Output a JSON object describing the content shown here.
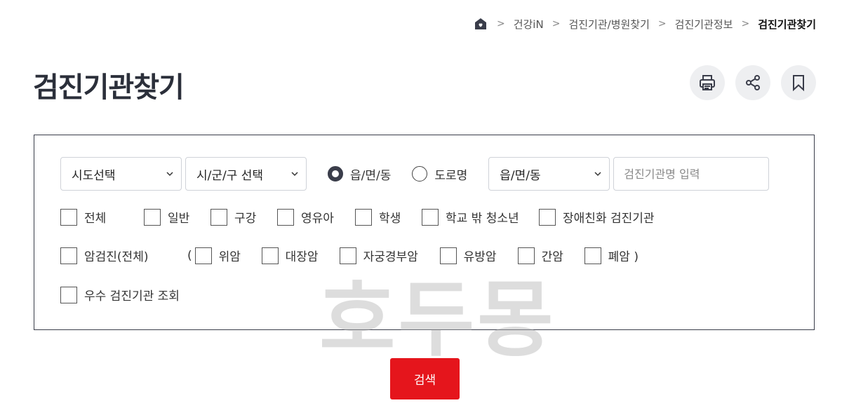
{
  "breadcrumb": {
    "items": [
      "건강iN",
      "검진기관/병원찾기",
      "검진기관정보"
    ],
    "current": "검진기관찾기"
  },
  "page_title": "검진기관찾기",
  "actions": {
    "icons": [
      "print-icon",
      "share-icon",
      "bookmark-icon"
    ]
  },
  "filters": {
    "sido_select": "시도선택",
    "sigungu_select": "시/군/구 선택",
    "radio_emd": "읍/면/동",
    "radio_road": "도로명",
    "emd_select": "읍/면/동",
    "name_placeholder": "검진기관명 입력"
  },
  "checks_row1": [
    "전체",
    "일반",
    "구강",
    "영유아",
    "학생",
    "학교 밖 청소년",
    "장애친화 검진기관"
  ],
  "checks_row2": {
    "cancer_all": "암검진(전체)",
    "open_paren": "(",
    "items": [
      "위암",
      "대장암",
      "자궁경부암",
      "유방암",
      "간암",
      "폐암 )"
    ]
  },
  "checks_row3": [
    "우수 검진기관 조회"
  ],
  "watermark": "호두몽",
  "search_button": "검색",
  "colors": {
    "accent": "#e5151c",
    "dark": "#3a3d4a"
  }
}
